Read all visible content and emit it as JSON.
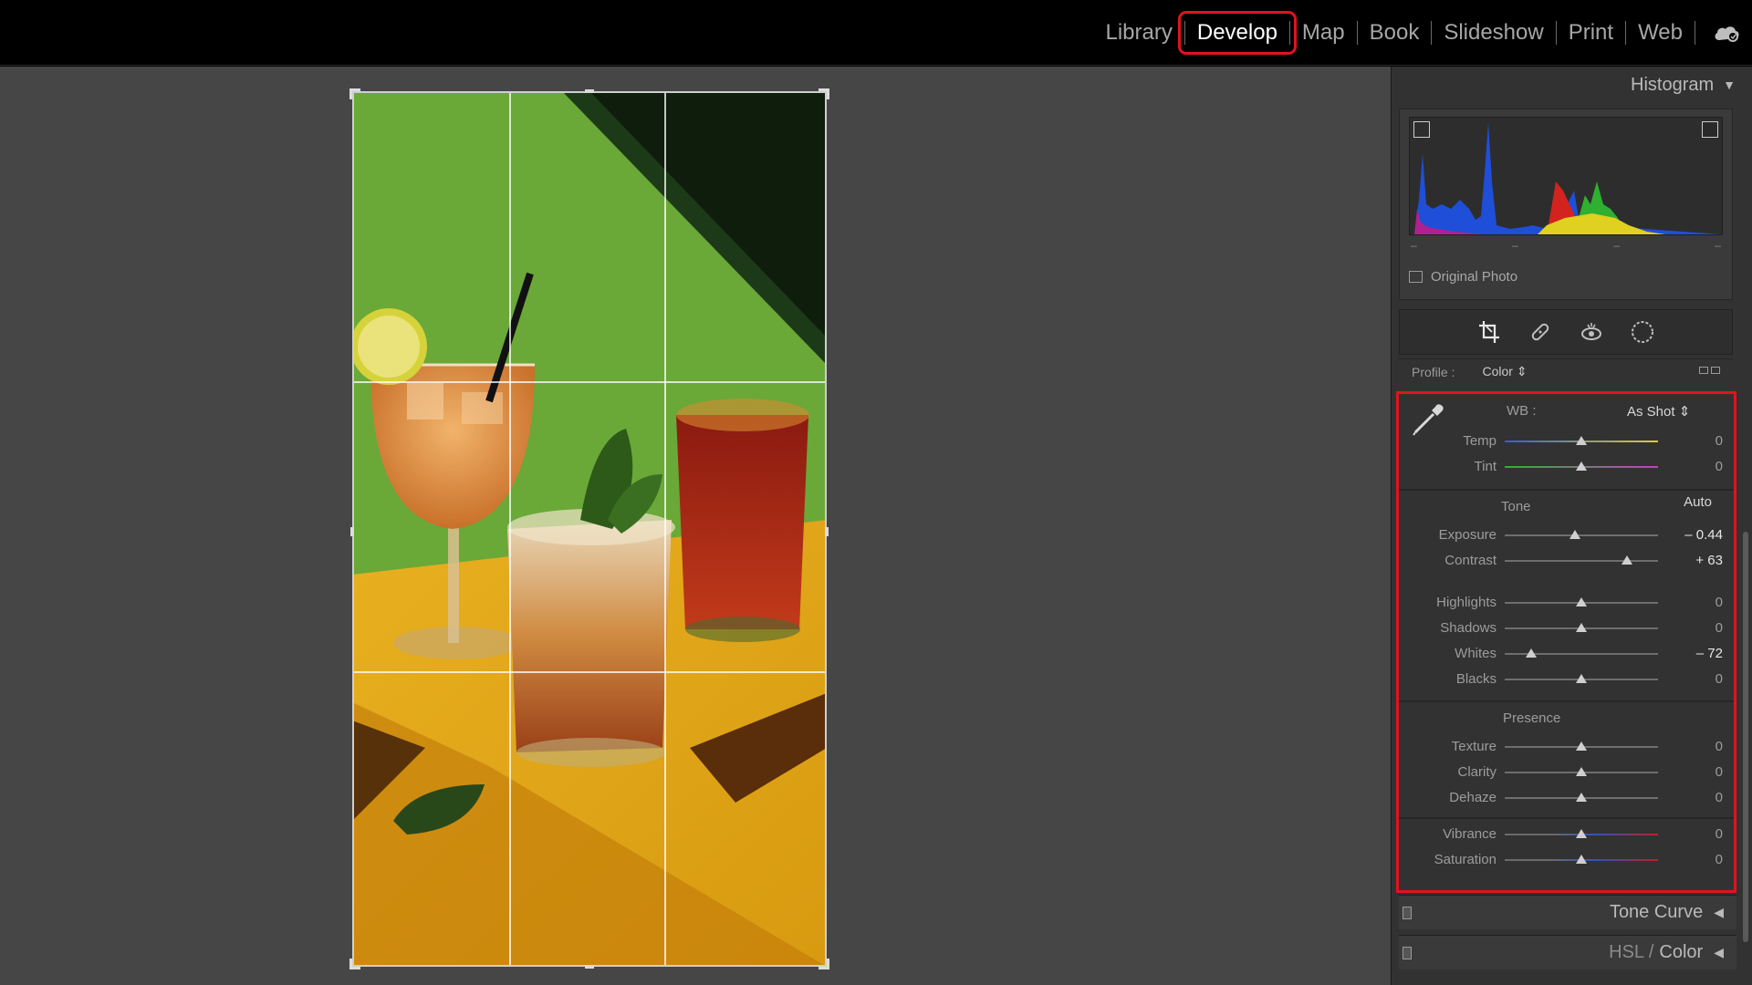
{
  "modules": [
    {
      "label": "Library",
      "active": false
    },
    {
      "label": "Develop",
      "active": true
    },
    {
      "label": "Map",
      "active": false
    },
    {
      "label": "Book",
      "active": false
    },
    {
      "label": "Slideshow",
      "active": false
    },
    {
      "label": "Print",
      "active": false
    },
    {
      "label": "Web",
      "active": false
    }
  ],
  "histogram": {
    "title": "Histogram",
    "dashes": [
      "–",
      "–",
      "–",
      "–"
    ],
    "original_photo_label": "Original Photo"
  },
  "profile": {
    "label": "Profile :",
    "value": "Color ⇕"
  },
  "basic": {
    "wb_label": "WB :",
    "wb_value": "As Shot ⇕",
    "tone_title": "Tone",
    "auto_label": "Auto",
    "presence_title": "Presence",
    "sliders": {
      "temp": {
        "label": "Temp",
        "value": "0",
        "pos": 0.5
      },
      "tint": {
        "label": "Tint",
        "value": "0",
        "pos": 0.5
      },
      "exposure": {
        "label": "Exposure",
        "value": "– 0.44",
        "pos": 0.46
      },
      "contrast": {
        "label": "Contrast",
        "value": "+ 63",
        "pos": 0.8
      },
      "highlights": {
        "label": "Highlights",
        "value": "0",
        "pos": 0.5
      },
      "shadows": {
        "label": "Shadows",
        "value": "0",
        "pos": 0.5
      },
      "whites": {
        "label": "Whites",
        "value": "– 72",
        "pos": 0.17
      },
      "blacks": {
        "label": "Blacks",
        "value": "0",
        "pos": 0.5
      },
      "texture": {
        "label": "Texture",
        "value": "0",
        "pos": 0.5
      },
      "clarity": {
        "label": "Clarity",
        "value": "0",
        "pos": 0.5
      },
      "dehaze": {
        "label": "Dehaze",
        "value": "0",
        "pos": 0.5
      },
      "vibrance": {
        "label": "Vibrance",
        "value": "0",
        "pos": 0.5
      },
      "saturation": {
        "label": "Saturation",
        "value": "0",
        "pos": 0.5
      }
    }
  },
  "panels": {
    "tone_curve": "Tone Curve",
    "hsl_prefix": "HSL / ",
    "hsl_color": "Color"
  },
  "colors": {
    "highlight_red": "#e1131f",
    "panel_bg": "#323232",
    "workspace_bg": "#464646"
  },
  "icons": [
    "cloud-icon",
    "crop-overlay-icon",
    "healing-icon",
    "red-eye-icon",
    "masking-icon",
    "eyedropper-icon"
  ]
}
